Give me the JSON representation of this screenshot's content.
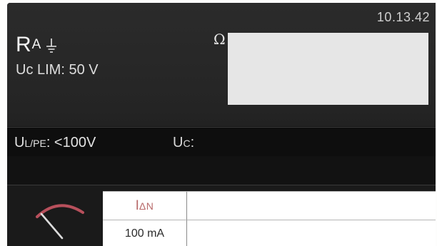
{
  "status": {
    "time": "10.13.42"
  },
  "function": {
    "main": "R",
    "sub": "A",
    "icon": "earth-ground-icon",
    "limit_text": "Uc LIM: 50 V"
  },
  "result": {
    "unit": "Ω",
    "value": ""
  },
  "info_bar": {
    "ulpe_main": "U",
    "ulpe_sub": "L/PE",
    "ulpe_value": ": <100V",
    "uc_main": "U",
    "uc_sub": "C",
    "uc_suffix": ":",
    "uc_value": ""
  },
  "message": "",
  "parameters": {
    "icon": "meter-needle-icon",
    "label_main": "I",
    "label_sub": "ΔN",
    "value": "100 mA"
  },
  "colors": {
    "screen_bg": "#161616",
    "result_box": "#e6e6e6",
    "param_label": "#b86a6a",
    "meter_arc": "#b8505c"
  }
}
